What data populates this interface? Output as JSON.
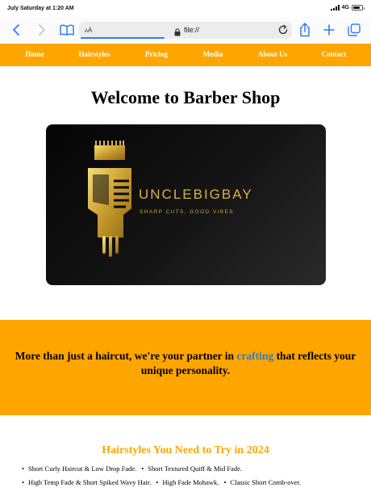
{
  "status_bar": {
    "time": "July Saturday at 1:20 AM",
    "network": "4G",
    "battery_level": 0.75
  },
  "browser": {
    "text_size_label": "AA",
    "url": "file://",
    "icons": [
      "back-icon",
      "forward-icon",
      "bookmarks-icon",
      "lock-icon",
      "reload-icon",
      "share-icon",
      "new-tab-icon",
      "tabs-icon"
    ]
  },
  "nav": {
    "items": [
      "Home",
      "Hairstyles",
      "Pricing",
      "Media",
      "About Us",
      "Contact"
    ]
  },
  "main": {
    "title": "Welcome to Barber Shop",
    "logo": {
      "brand": "UNCLEBIGBAY",
      "tagline": "SHARP CUTS, GOOD VIBES",
      "accent_color": "#d6b24a"
    }
  },
  "banner": {
    "text_before": "More than just a haircut, we're your partner in ",
    "link_text": "crafting",
    "text_after": " that reflects your unique personality."
  },
  "hairstyles": {
    "title": "Hairstyles You Need to Try in 2024",
    "rows": [
      [
        "Short Curly Haircut & Low Drop Fade.",
        "Short Textured Quiff & Mid Fade."
      ],
      [
        "High Temp Fade & Short Spiked Wavy Hair.",
        "High Fade Mohawk.",
        "Classic Short Comb-over."
      ]
    ]
  },
  "colors": {
    "brand_orange": "#ffa500",
    "link_blue": "#2f7fc1",
    "url_underline": "#2f7cf6"
  }
}
